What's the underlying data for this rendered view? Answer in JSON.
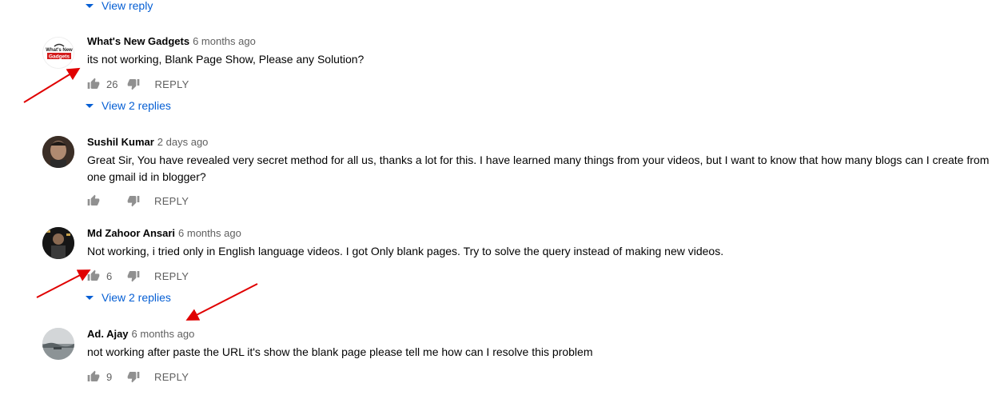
{
  "top_view_reply": {
    "label": "View reply"
  },
  "comments": [
    {
      "author": "What's New Gadgets",
      "time": "6 months ago",
      "text": "its not working, Blank Page Show, Please any Solution?",
      "likes": "26",
      "reply_label": "REPLY",
      "view_replies": "View 2 replies"
    },
    {
      "author": "Sushil Kumar",
      "time": "2 days ago",
      "text": "Great Sir, You have revealed very secret method for all us, thanks a lot for this. I have learned many things from your videos, but I want to know that how many blogs can I create from one gmail id in blogger?",
      "likes": "",
      "reply_label": "REPLY"
    },
    {
      "author": "Md Zahoor Ansari",
      "time": "6 months ago",
      "text": "Not working, i tried only in English language videos. I got Only blank pages. Try to solve the query instead of making new videos.",
      "likes": "6",
      "reply_label": "REPLY",
      "view_replies": "View 2 replies"
    },
    {
      "author": "Ad. Ajay",
      "time": "6 months ago",
      "text": "not working after paste the URL it's show the blank page please tell me how can I resolve this problem",
      "likes": "9",
      "reply_label": "REPLY"
    }
  ],
  "logo": {
    "line1": "What's New",
    "line2": "Gadgets"
  },
  "colors": {
    "link": "#065fd4",
    "secondary": "#606060",
    "annotation_arrow": "#e00000"
  },
  "icons": [
    "thumb-up-icon",
    "thumb-down-icon",
    "caret-down-icon"
  ]
}
